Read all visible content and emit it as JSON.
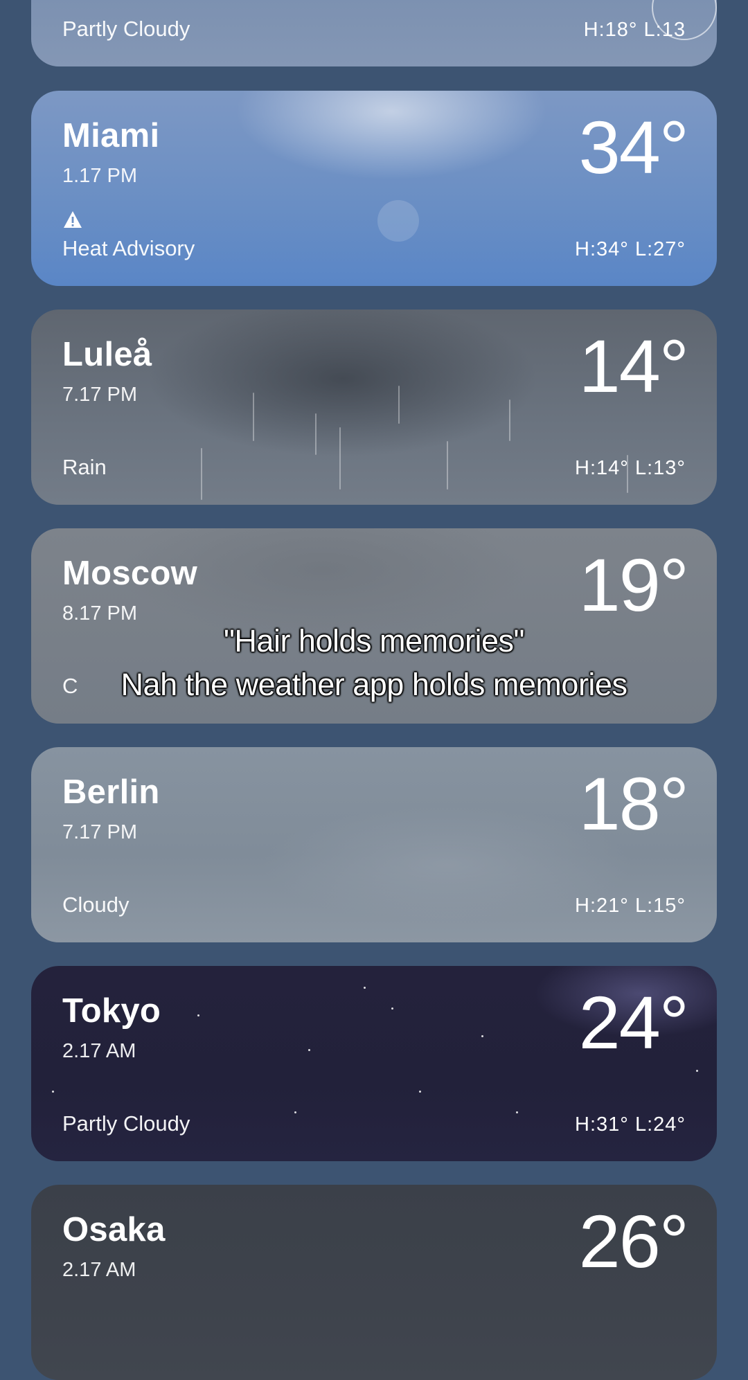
{
  "cards": [
    {
      "city": "",
      "time": "",
      "temp": "",
      "condition": "Partly Cloudy",
      "hilo": "H:18°  L:13"
    },
    {
      "city": "Miami",
      "time": "1.17 PM",
      "temp": "34°",
      "condition": "Heat Advisory",
      "hilo": "H:34°  L:27°",
      "icon": "warning-triangle-icon"
    },
    {
      "city": "Luleå",
      "time": "7.17 PM",
      "temp": "14°",
      "condition": "Rain",
      "hilo": "H:14°  L:13°"
    },
    {
      "city": "Moscow",
      "time": "8.17 PM",
      "temp": "19°",
      "condition": "C",
      "hilo": ""
    },
    {
      "city": "Berlin",
      "time": "7.17 PM",
      "temp": "18°",
      "condition": "Cloudy",
      "hilo": "H:21°  L:15°"
    },
    {
      "city": "Tokyo",
      "time": "2.17 AM",
      "temp": "24°",
      "condition": "Partly Cloudy",
      "hilo": "H:31°  L:24°"
    },
    {
      "city": "Osaka",
      "time": "2.17 AM",
      "temp": "26°",
      "condition": "",
      "hilo": ""
    }
  ],
  "caption": {
    "line1": "\"Hair holds memories\"",
    "line2": "Nah the weather app holds memories"
  }
}
